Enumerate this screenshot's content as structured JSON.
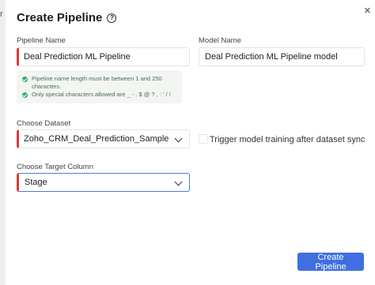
{
  "dialog": {
    "title": "Create Pipeline",
    "help_glyph": "?",
    "close_glyph": "×",
    "submit_label": "Create Pipeline"
  },
  "backdrop": {
    "text": "r"
  },
  "form": {
    "pipeline_name": {
      "label": "Pipeline Name",
      "value": "Deal Prediction ML Pipeline"
    },
    "model_name": {
      "label": "Model Name",
      "value": "Deal Prediction ML Pipeline model"
    },
    "hints": [
      "Pipeline name length must be between 1 and 250 characters.",
      "Only special characters allowed are _ - . $ @ ? , : ' / !"
    ],
    "dataset": {
      "label": "Choose Dataset",
      "value": "Zoho_CRM_Deal_Prediction_Sample"
    },
    "trigger_training": {
      "label": "Trigger model training after dataset sync",
      "checked": false
    },
    "target_column": {
      "label": "Choose Target Column",
      "value": "Stage"
    }
  },
  "colors": {
    "accent": "#3f6fe0",
    "required_marker": "#d93a3a",
    "hint_check": "#3aa676"
  }
}
